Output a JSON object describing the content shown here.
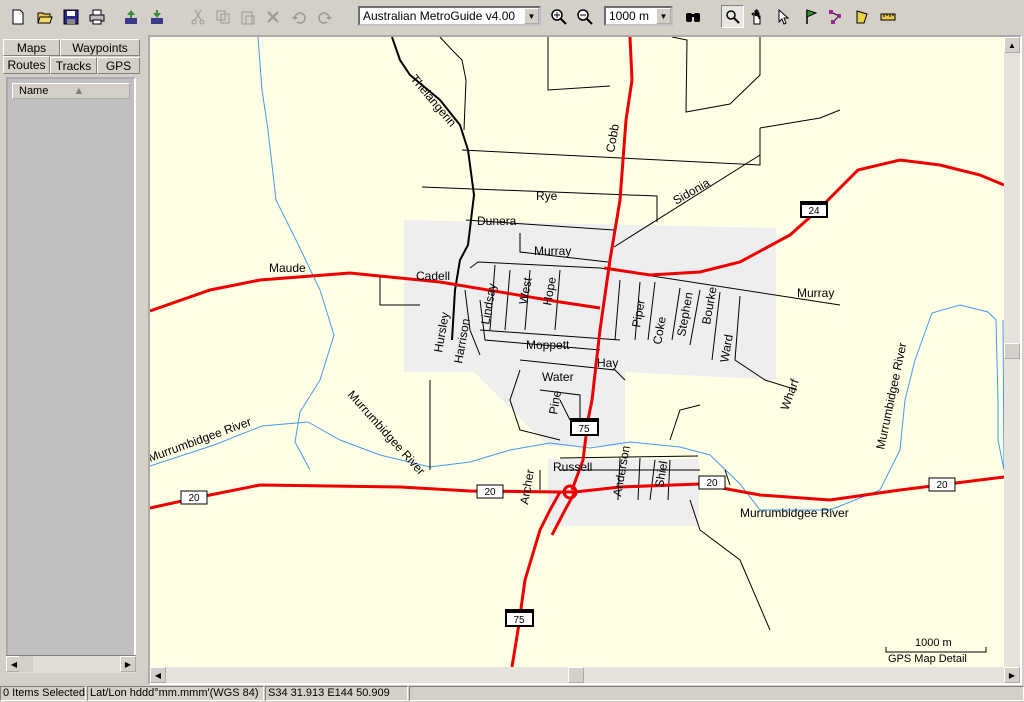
{
  "toolbar": {
    "map_product": "Australian MetroGuide v4.00",
    "zoom_level": "1000 m",
    "buttons": [
      "new-icon",
      "open-icon",
      "save-icon",
      "print-icon",
      "send-to-device-icon",
      "receive-from-device-icon",
      "cut-icon",
      "copy-icon",
      "paste-icon",
      "delete-icon",
      "undo-icon",
      "redo-icon",
      "zoom-in-icon",
      "zoom-out-icon",
      "find-icon",
      "zoom-tool-icon",
      "pan-tool-icon",
      "select-tool-icon",
      "waypoint-tool-icon",
      "route-tool-icon",
      "area-tool-icon",
      "measure-tool-icon"
    ]
  },
  "sidebar": {
    "tabs_row1": [
      "Maps",
      "Waypoints"
    ],
    "tabs_row2": [
      "Routes",
      "Tracks",
      "GPS"
    ],
    "active_tab": "Routes",
    "column_header": "Name"
  },
  "map": {
    "roads": [
      "Thelangerin",
      "Cobb",
      "Rye",
      "Sidonia",
      "Dunera",
      "Murray",
      "Cadell",
      "Maude",
      "Murray",
      "Lindsay",
      "West",
      "Hope",
      "Piper",
      "Coke",
      "Stephen",
      "Bourke",
      "Hursley",
      "Harrison",
      "Moppett",
      "Hay",
      "Water",
      "Pine",
      "Ward",
      "Wharf",
      "Russell",
      "Archer",
      "Anderson",
      "Shiel"
    ],
    "rivers": [
      "Murrumbidgee River",
      "Murrumbidgee River",
      "Murrumbidgee River",
      "Murrumbidgee River"
    ],
    "shields": [
      "24",
      "75",
      "75",
      "20",
      "20",
      "20",
      "20"
    ],
    "scale_label": "1000 m",
    "detail_label": "GPS Map Detail"
  },
  "status": {
    "selection": "0 Items Selected",
    "coord_format": "Lat/Lon hddd°mm.mmm'(WGS 84)",
    "cursor_position": "S34 31.913 E144 50.909"
  },
  "colors": {
    "map_background": "#ffffe6",
    "urban_area": "#eeeeee",
    "highway": "#ee0000",
    "water": "#4499ee",
    "chrome": "#d4d0c8"
  }
}
